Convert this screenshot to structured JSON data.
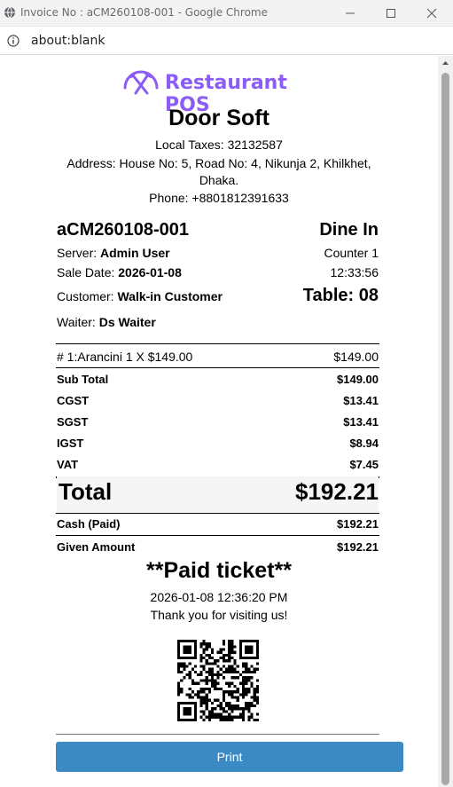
{
  "window": {
    "title": "Invoice No : aCM260108-001 - Google Chrome",
    "url": "about:blank"
  },
  "brand": {
    "logo_text": "Restaurant POS",
    "color": "#8b5cf6"
  },
  "store": {
    "name": "Door Soft",
    "taxes": "Local Taxes: 32132587",
    "address_line1": "Address: House No: 5, Road No: 4, Nikunja 2, Khilkhet,",
    "address_line2": "Dhaka.",
    "phone": "Phone: +8801812391633"
  },
  "invoice": {
    "number": "aCM260108-001",
    "order_type": "Dine In",
    "server_label": "Server:",
    "server": "Admin User",
    "counter": "Counter 1",
    "sale_date_label": "Sale Date:",
    "sale_date": "2026-01-08",
    "time": "12:33:56",
    "customer_label": "Customer:",
    "customer": "Walk-in Customer",
    "table": "Table: 08",
    "waiter_label": "Waiter:",
    "waiter": "Ds Waiter"
  },
  "items": [
    {
      "desc": "# 1:Arancini   1 X $149.00",
      "amount": "$149.00"
    }
  ],
  "totals": {
    "subtotal_label": "Sub Total",
    "subtotal": "$149.00",
    "cgst_label": "CGST",
    "cgst": "$13.41",
    "sgst_label": "SGST",
    "sgst": "$13.41",
    "igst_label": "IGST",
    "igst": "$8.94",
    "vat_label": "VAT",
    "vat": "$7.45",
    "total_label": "Total",
    "total": "$192.21",
    "cash_label": "Cash (Paid)",
    "cash": "$192.21",
    "given_label": "Given Amount",
    "given": "$192.21"
  },
  "footer": {
    "status": "**Paid ticket**",
    "datetime": "2026-01-08 12:36:20 PM",
    "thanks": "Thank you for visiting us!",
    "print_label": "Print"
  },
  "colors": {
    "print_button": "#3b8ac4",
    "logo": "#8b5cf6"
  }
}
